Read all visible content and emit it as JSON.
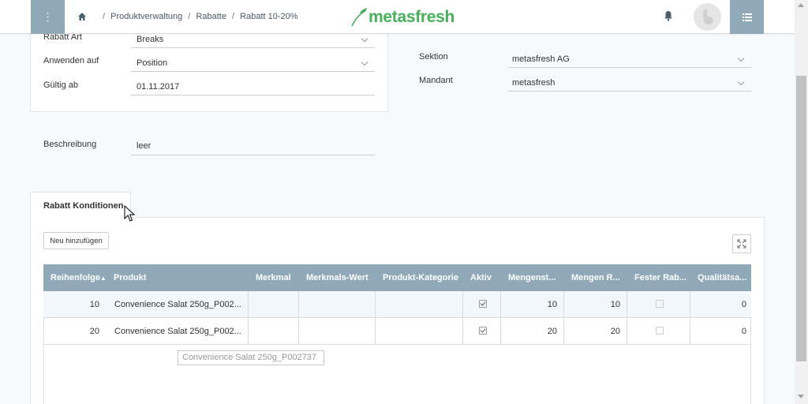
{
  "header": {
    "breadcrumb": [
      "Produktverwaltung",
      "Rabatte",
      "Rabatt 10-20%"
    ],
    "logo_text": "metasfresh",
    "brand_color": "#46b15b",
    "accent_color": "#8fa9b8"
  },
  "form_left": {
    "rabatt_art": {
      "label": "Rabatt Art",
      "value": "Breaks"
    },
    "anwenden_auf": {
      "label": "Anwenden auf",
      "value": "Position"
    },
    "gueltig_ab": {
      "label": "Gültig ab",
      "value": "01.11.2017"
    }
  },
  "form_right": {
    "sektion": {
      "label": "Sektion",
      "value": "metasfresh AG"
    },
    "mandant": {
      "label": "Mandant",
      "value": "metasfresh"
    }
  },
  "beschreibung": {
    "label": "Beschreibung",
    "value": "leer"
  },
  "tab": {
    "label": "Rabatt Konditionen"
  },
  "buttons": {
    "add": "Neu hinzufügen"
  },
  "table": {
    "columns": [
      "Reihenfolge",
      "Produkt",
      "Merkmal",
      "Merkmals-Wert",
      "Produkt-Kategorie",
      "Aktiv",
      "Mengenst...",
      "Mengen R...",
      "Fester Rab...",
      "Qualitätsa..."
    ],
    "sort_indicator": "▲",
    "rows": [
      {
        "reihenfolge": "10",
        "produkt": "Convenience Salat 250g_P002...",
        "merkmal": "",
        "merkmals_wert": "",
        "produkt_kategorie": "",
        "aktiv": true,
        "mengenst": "10",
        "mengen_r": "10",
        "fester_rab": false,
        "qualitaetsa": "0"
      },
      {
        "reihenfolge": "20",
        "produkt": "Convenience Salat 250g_P002...",
        "merkmal": "",
        "merkmals_wert": "",
        "produkt_kategorie": "",
        "aktiv": true,
        "mengenst": "20",
        "mengen_r": "20",
        "fester_rab": false,
        "qualitaetsa": "0"
      }
    ]
  },
  "tooltip": "Convenience Salat 250g_P002737"
}
